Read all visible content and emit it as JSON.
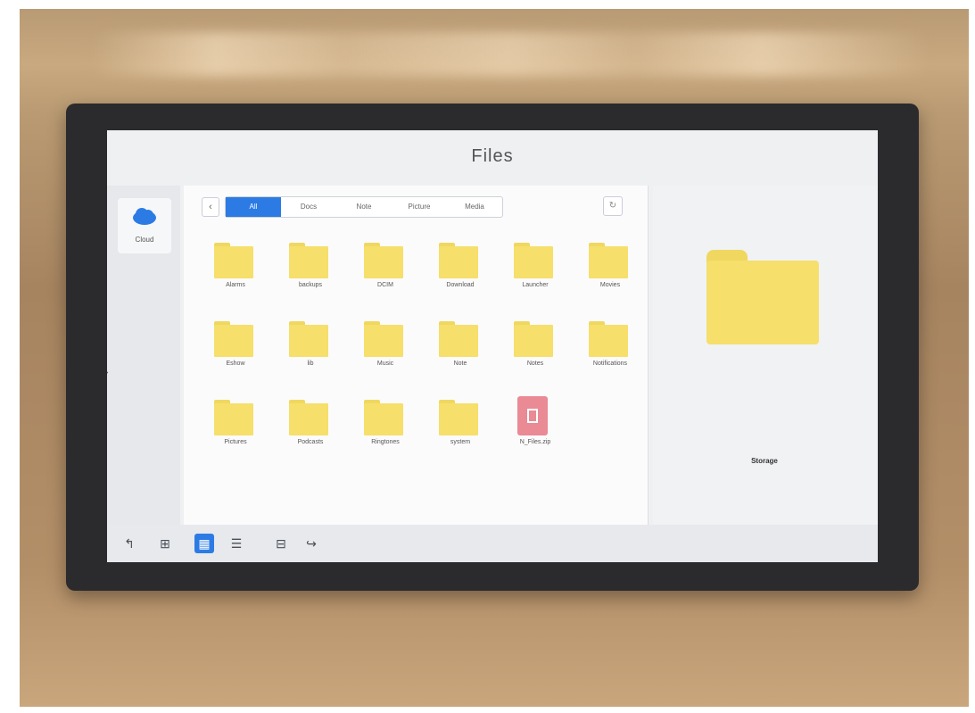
{
  "window": {
    "title": "Files"
  },
  "sidebar": {
    "items": [
      {
        "label": "Cloud",
        "icon": "cloud-icon"
      }
    ]
  },
  "nav": {
    "back_icon": "‹",
    "refresh_icon": "↻"
  },
  "tabs": [
    {
      "label": "All",
      "active": true
    },
    {
      "label": "Docs",
      "active": false
    },
    {
      "label": "Note",
      "active": false
    },
    {
      "label": "Picture",
      "active": false
    },
    {
      "label": "Media",
      "active": false
    }
  ],
  "files": [
    {
      "name": "Alarms",
      "type": "folder"
    },
    {
      "name": "backups",
      "type": "folder"
    },
    {
      "name": "DCIM",
      "type": "folder"
    },
    {
      "name": "Download",
      "type": "folder"
    },
    {
      "name": "Launcher",
      "type": "folder"
    },
    {
      "name": "Movies",
      "type": "folder"
    },
    {
      "name": "Eshow",
      "type": "folder"
    },
    {
      "name": "lib",
      "type": "folder"
    },
    {
      "name": "Music",
      "type": "folder"
    },
    {
      "name": "Note",
      "type": "folder"
    },
    {
      "name": "Notes",
      "type": "folder"
    },
    {
      "name": "Notifications",
      "type": "folder"
    },
    {
      "name": "Pictures",
      "type": "folder"
    },
    {
      "name": "Podcasts",
      "type": "folder"
    },
    {
      "name": "Ringtones",
      "type": "folder"
    },
    {
      "name": "system",
      "type": "folder"
    },
    {
      "name": "N_Files.zip",
      "type": "zip"
    }
  ],
  "preview": {
    "name": "Storage",
    "subtitle": ""
  },
  "toolbar": {
    "items": [
      {
        "icon": "↰",
        "name": "back-icon",
        "active": false
      },
      {
        "icon": "⊞",
        "name": "apps-icon",
        "active": false
      },
      {
        "icon": "▦",
        "name": "grid-view-icon",
        "active": true
      },
      {
        "icon": "☰",
        "name": "list-view-icon",
        "active": false
      },
      {
        "icon": "⊟",
        "name": "window-icon",
        "active": false
      },
      {
        "icon": "↪",
        "name": "return-icon",
        "active": false
      }
    ]
  },
  "colors": {
    "accent": "#2c7be5",
    "folder": "#f6df6b",
    "zip": "#e98a94",
    "bezel": "#2b2b2e"
  }
}
